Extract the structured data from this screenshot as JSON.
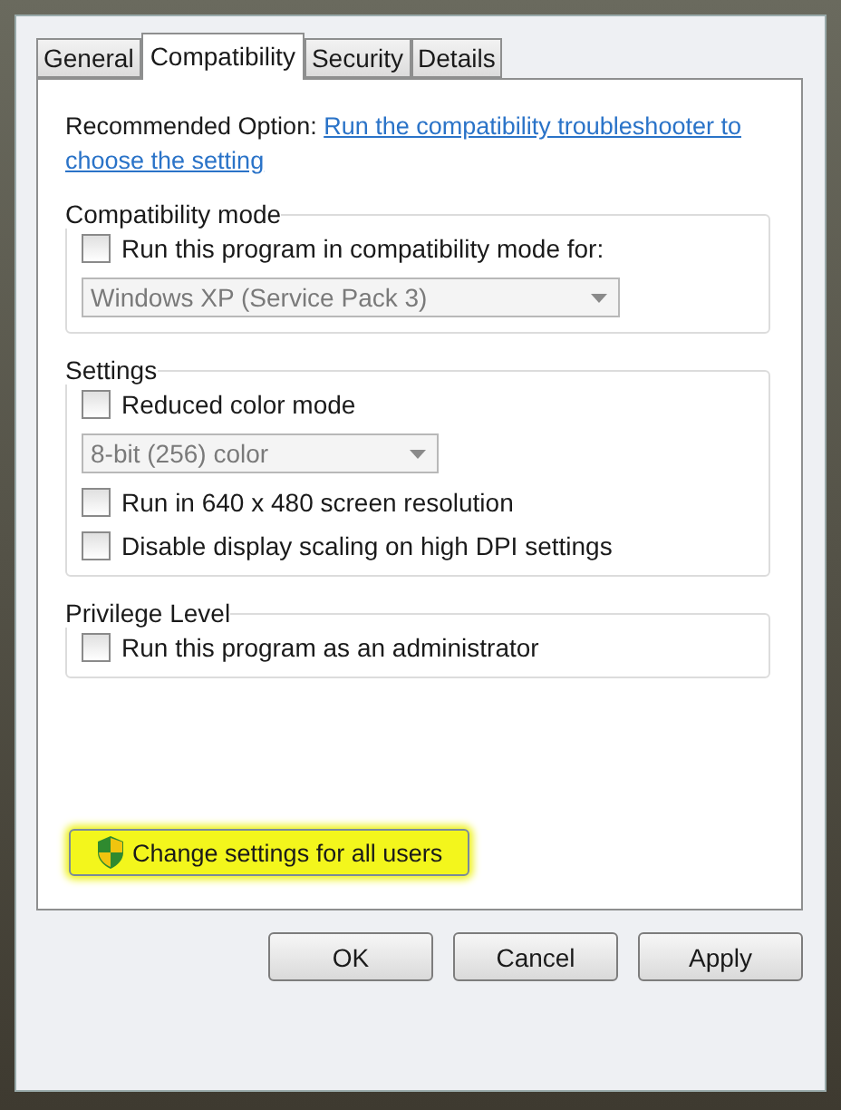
{
  "tabs": [
    {
      "label": "General",
      "selected": false
    },
    {
      "label": "Compatibility",
      "selected": true
    },
    {
      "label": "Security",
      "selected": false
    },
    {
      "label": "Details",
      "selected": false
    }
  ],
  "recommended": {
    "label": "Recommended Option:",
    "link_lines": [
      "Run the compatibility troubleshooter to",
      "choose the setting"
    ]
  },
  "groups": [
    {
      "title": "Compatibility mode",
      "items": [
        {
          "kind": "checkbox",
          "label": "Run this program in compatibility mode for:",
          "checked": false
        },
        {
          "kind": "dropdown",
          "value": "Windows XP (Service Pack 3)",
          "disabled": true
        }
      ]
    },
    {
      "title": "Settings",
      "items": [
        {
          "kind": "checkbox",
          "label": "Reduced color mode",
          "checked": false
        },
        {
          "kind": "dropdown",
          "value": "8-bit (256) color",
          "disabled": true
        },
        {
          "kind": "checkbox",
          "label": "Run in 640 x 480 screen resolution",
          "checked": false
        },
        {
          "kind": "checkbox",
          "label": "Disable display scaling on high DPI settings",
          "checked": false
        }
      ]
    },
    {
      "title": "Privilege Level",
      "items": [
        {
          "kind": "checkbox",
          "label": "Run this program as an administrator",
          "checked": false
        }
      ]
    }
  ],
  "change_button": {
    "label": "Change settings for all users",
    "highlighted": true
  },
  "buttons": [
    {
      "label": "OK"
    },
    {
      "label": "Cancel"
    },
    {
      "label": "Apply"
    }
  ]
}
